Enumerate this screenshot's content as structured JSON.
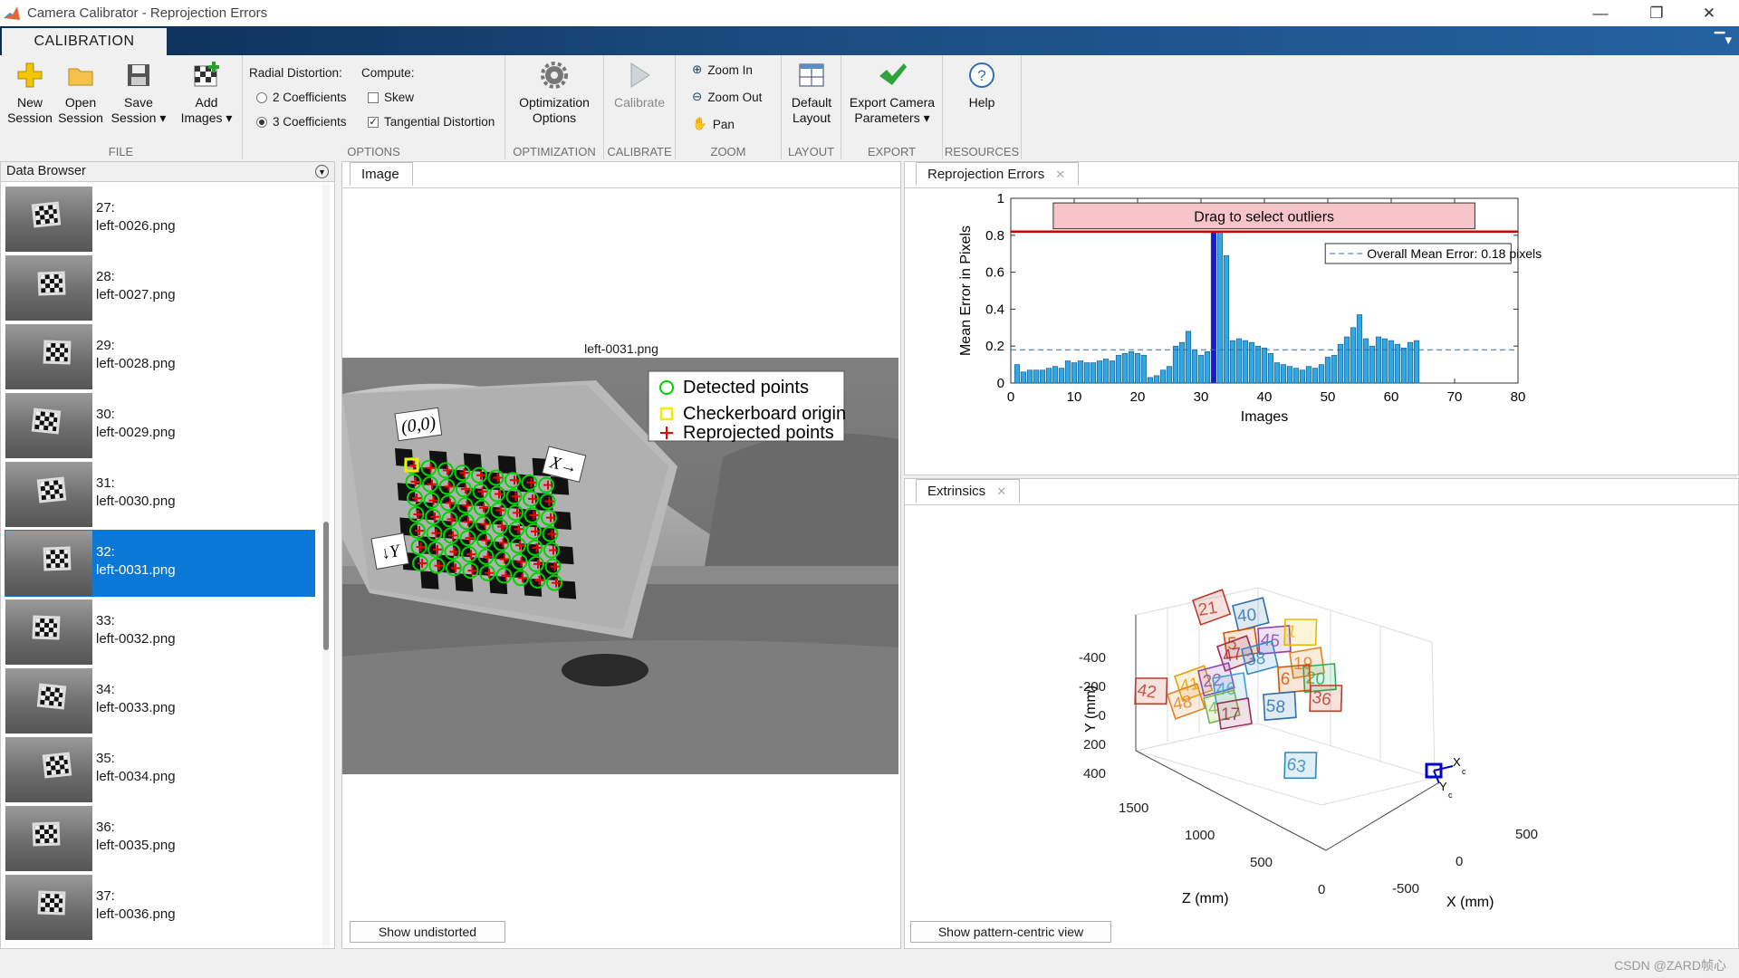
{
  "window": {
    "title": "Camera Calibrator - Reprojection Errors",
    "minimize": "—",
    "restore": "❐",
    "close": "✕"
  },
  "tab": {
    "label": "CALIBRATION"
  },
  "ribbon": {
    "file": {
      "label": "FILE",
      "new_session": [
        "New",
        "Session"
      ],
      "open_session": [
        "Open",
        "Session"
      ],
      "save_session": [
        "Save",
        "Session ▾"
      ],
      "add_images": [
        "Add",
        "Images ▾"
      ]
    },
    "options": {
      "label": "OPTIONS",
      "radial_label": "Radial Distortion:",
      "compute_label": "Compute:",
      "coef2": "2 Coefficients",
      "coef3": "3 Coefficients",
      "skew": "Skew",
      "tangential": "Tangential Distortion",
      "coef_selected": "3",
      "skew_checked": false,
      "tangential_checked": true
    },
    "optimization": {
      "label": "OPTIMIZATION",
      "button": [
        "Optimization",
        "Options"
      ]
    },
    "calibrate": {
      "label": "CALIBRATE",
      "button": "Calibrate"
    },
    "zoom": {
      "label": "ZOOM",
      "zoom_in": "Zoom In",
      "zoom_out": "Zoom Out",
      "pan": "Pan"
    },
    "layout": {
      "label": "LAYOUT",
      "button": [
        "Default",
        "Layout"
      ]
    },
    "export": {
      "label": "EXPORT",
      "button": [
        "Export Camera",
        "Parameters ▾"
      ]
    },
    "resources": {
      "label": "RESOURCES",
      "button": "Help"
    }
  },
  "browser": {
    "title": "Data Browser",
    "selected_index": 5,
    "items": [
      {
        "num": "27:",
        "file": "left-0026.png"
      },
      {
        "num": "28:",
        "file": "left-0027.png"
      },
      {
        "num": "29:",
        "file": "left-0028.png"
      },
      {
        "num": "30:",
        "file": "left-0029.png"
      },
      {
        "num": "31:",
        "file": "left-0030.png"
      },
      {
        "num": "32:",
        "file": "left-0031.png"
      },
      {
        "num": "33:",
        "file": "left-0032.png"
      },
      {
        "num": "34:",
        "file": "left-0033.png"
      },
      {
        "num": "35:",
        "file": "left-0034.png"
      },
      {
        "num": "36:",
        "file": "left-0035.png"
      },
      {
        "num": "37:",
        "file": "left-0036.png"
      }
    ]
  },
  "image_panel": {
    "tab": "Image",
    "image_title": "left-0031.png",
    "legend": [
      "Detected points",
      "Checkerboard origin",
      "Reprojected points"
    ],
    "origin_label": "(0,0)",
    "x_label": "X→",
    "y_label": "↓Y",
    "button": "Show undistorted"
  },
  "reproj_panel": {
    "tab": "Reprojection Errors",
    "close": "✕"
  },
  "extrinsics_panel": {
    "tab": "Extrinsics",
    "close": "✕",
    "button": "Show pattern-centric view",
    "axes": {
      "ylabel": "Y (mm)",
      "zlabel": "Z (mm)",
      "xlabel": "X (mm)",
      "yticks": [
        "-400",
        "-200",
        "0",
        "200",
        "400"
      ],
      "zticks": [
        "1500",
        "1000",
        "500",
        "0"
      ],
      "xticks": [
        "500",
        "0",
        "-500"
      ],
      "cam_x": "X",
      "cam_y": "Y",
      "cam_sub": "c"
    },
    "board_labels": [
      "21",
      "40",
      "5",
      "45",
      "1",
      "47",
      "38",
      "19",
      "20",
      "42",
      "41",
      "22",
      "46",
      "6",
      "36",
      "48",
      "4",
      "17",
      "58",
      "63"
    ]
  },
  "chart_data": {
    "type": "bar",
    "ylabel": "Mean Error in Pixels",
    "xlabel": "Images",
    "xlim": [
      0,
      80
    ],
    "ylim": [
      0,
      1
    ],
    "xticks": [
      0,
      10,
      20,
      30,
      40,
      50,
      60,
      70,
      80
    ],
    "yticks": [
      0,
      0.2,
      0.4,
      0.6,
      0.8,
      1
    ],
    "ytick_labels": [
      "0",
      "0.2",
      "0.4",
      "0.6",
      "0.8",
      "1"
    ],
    "selected_image": 32,
    "values": [
      0.1,
      0.06,
      0.07,
      0.07,
      0.07,
      0.08,
      0.09,
      0.08,
      0.12,
      0.11,
      0.12,
      0.11,
      0.11,
      0.12,
      0.13,
      0.12,
      0.15,
      0.16,
      0.17,
      0.16,
      0.15,
      0.03,
      0.04,
      0.07,
      0.09,
      0.2,
      0.22,
      0.28,
      0.18,
      0.15,
      0.17,
      0.19,
      0.82,
      0.69,
      0.23,
      0.24,
      0.23,
      0.22,
      0.2,
      0.19,
      0.16,
      0.11,
      0.1,
      0.09,
      0.08,
      0.07,
      0.09,
      0.08,
      0.1,
      0.14,
      0.15,
      0.21,
      0.25,
      0.3,
      0.37,
      0.24,
      0.2,
      0.25,
      0.24,
      0.23,
      0.21,
      0.19,
      0.22,
      0.23
    ],
    "mean_error": 0.18,
    "legend": "Overall Mean Error: 0.18 pixels",
    "outlier_box_label": "Drag to select outliers",
    "threshold": 0.82,
    "colors": {
      "bar": "#2fa8e6",
      "selected": "#1a1acc",
      "threshold": "#d40000",
      "mean": "#2e6fb0",
      "outlier_box": "#f7c4c9"
    }
  },
  "watermark": "CSDN @ZARD帧心"
}
